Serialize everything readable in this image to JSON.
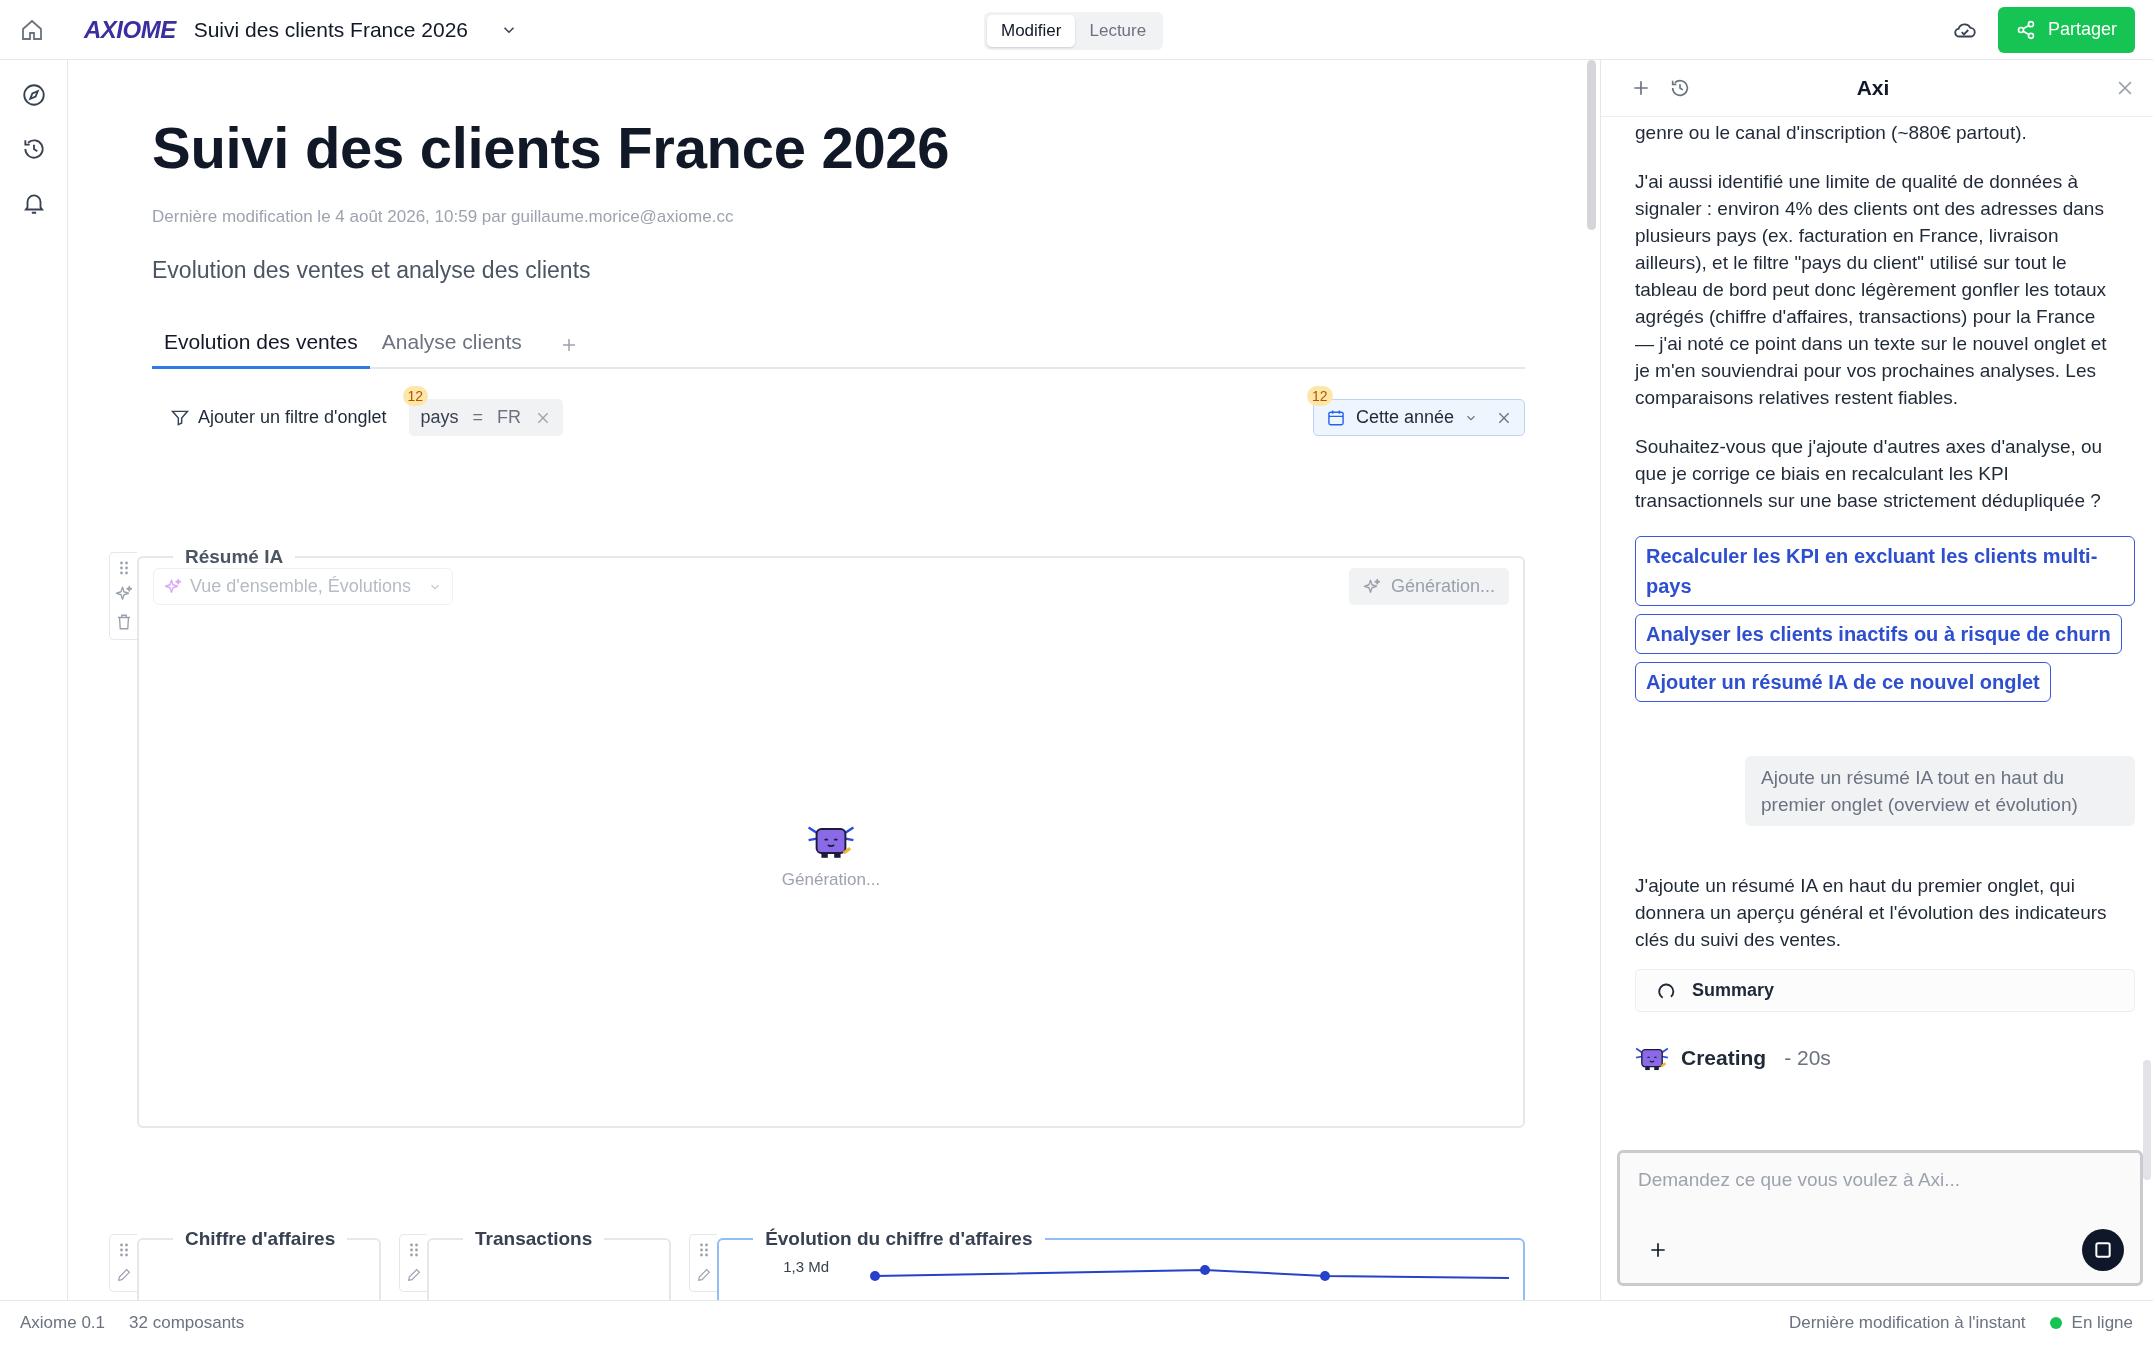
{
  "topbar": {
    "logo": "AXIOME",
    "doc_title": "Suivi des clients France 2026",
    "modes": [
      {
        "label": "Modifier",
        "selected": true
      },
      {
        "label": "Lecture",
        "selected": false
      }
    ],
    "share": "Partager"
  },
  "page": {
    "title": "Suivi des clients France 2026",
    "modified": "Dernière modification le 4 août 2026, 10:59 par guillaume.morice@axiome.cc",
    "subtitle": "Evolution des ventes et analyse des clients"
  },
  "tabs": [
    {
      "label": "Evolution des ventes",
      "selected": true
    },
    {
      "label": "Analyse clients",
      "selected": false
    }
  ],
  "filters": {
    "add_label": "Ajouter un filtre d'onglet",
    "chips": [
      {
        "badge": "12",
        "field": "pays",
        "op": "=",
        "value": "FR"
      }
    ],
    "date": {
      "badge": "12",
      "label": "Cette année"
    }
  },
  "ai_summary": {
    "title": "Résumé IA",
    "select": "Vue d'ensemble, Évolutions",
    "generate": "Génération...",
    "status": "Génération..."
  },
  "cards": [
    {
      "title": "Chiffre d'affaires",
      "kind": "kpi",
      "selected": false
    },
    {
      "title": "Transactions",
      "kind": "kpi",
      "selected": false
    },
    {
      "title": "Évolution du chiffre d'affaires",
      "kind": "chart",
      "selected": true,
      "axis_label": "1,3 Md"
    }
  ],
  "chat": {
    "title": "Axi",
    "messages": [
      {
        "kind": "assistant",
        "text": "genre ou le canal d'inscription (~880€ partout)."
      },
      {
        "kind": "assistant",
        "text": "J'ai aussi identifié une limite de qualité de données à signaler : environ 4% des clients ont des adresses dans plusieurs pays (ex. facturation en France, livraison ailleurs), et le filtre \"pays du client\" utilisé sur tout le tableau de bord peut donc légèrement gonfler les totaux agrégés (chiffre d'affaires, transactions) pour la France — j'ai noté ce point dans un texte sur le nouvel onglet et je m'en souviendrai pour vos prochaines analyses. Les comparaisons relatives restent fiables."
      },
      {
        "kind": "assistant",
        "text": "Souhaitez-vous que j'ajoute d'autres axes d'analyse, ou que je corrige ce biais en recalculant les KPI transactionnels sur une base strictement dédupliquée ?"
      },
      {
        "kind": "suggestion",
        "text": "Recalculer les KPI en excluant les clients multi-pays"
      },
      {
        "kind": "suggestion",
        "text": "Analyser les clients inactifs ou à risque de churn"
      },
      {
        "kind": "suggestion",
        "text": "Ajouter un résumé IA de ce nouvel onglet"
      },
      {
        "kind": "user",
        "text": "Ajoute un résumé IA tout en haut du premier onglet (overview et évolution)"
      },
      {
        "kind": "assistant",
        "text": "J'ajoute un résumé IA en haut du premier onglet, qui donnera un aperçu général et l'évolution des indicateurs clés du suivi des ventes."
      },
      {
        "kind": "tool",
        "text": "Summary"
      },
      {
        "kind": "status",
        "text": "Creating",
        "elapsed": "- 20s"
      }
    ],
    "input": {
      "placeholder": "Demandez ce que vous voulez à Axi..."
    }
  },
  "status_bar": {
    "version": "Axiome 0.1",
    "components": "32 composants",
    "saved": "Dernière modification à l'instant",
    "connection": "En ligne",
    "online": true
  }
}
